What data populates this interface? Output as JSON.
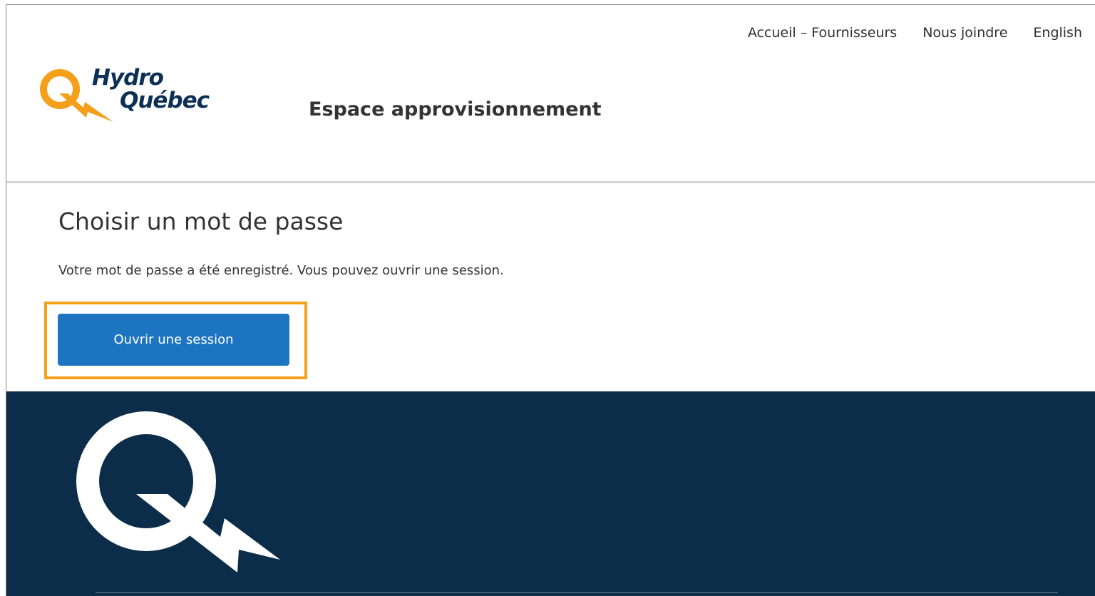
{
  "header": {
    "nav": [
      {
        "label": "Accueil – Fournisseurs"
      },
      {
        "label": "Nous joindre"
      },
      {
        "label": "English"
      }
    ],
    "logo": {
      "line1": "Hydro",
      "line2": "Québec",
      "icon": "hydro-quebec-q-logo",
      "accent_color": "#f5a01a",
      "text_color": "#0b2f55"
    },
    "site_title": "Espace approvisionnement"
  },
  "main": {
    "heading": "Choisir un mot de passe",
    "message": "Votre mot de passe a été enregistré. Vous pouvez ouvrir une session.",
    "button_label": "Ouvrir une session",
    "button_color": "#1d75c2",
    "highlight_color": "#f5a01a"
  },
  "footer": {
    "logo_icon": "hydro-quebec-q-logo-white",
    "background_color": "#0c2d4a"
  }
}
